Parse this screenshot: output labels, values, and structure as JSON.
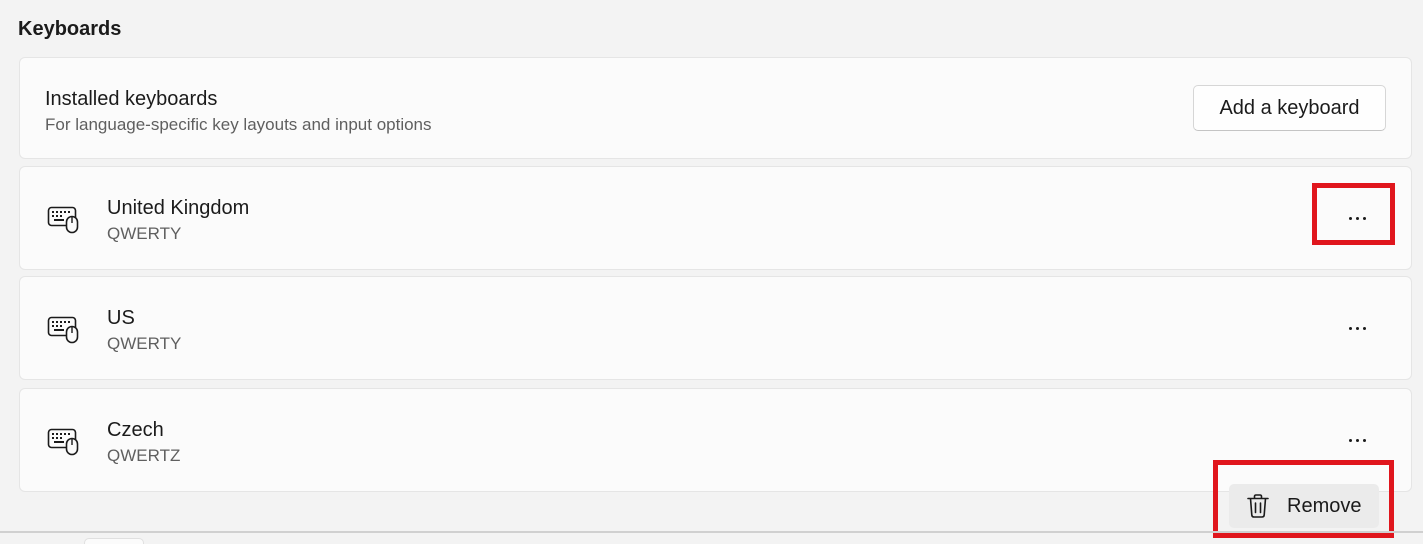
{
  "section": {
    "title": "Keyboards"
  },
  "installed": {
    "title": "Installed keyboards",
    "subtitle": "For language-specific key layouts and input options",
    "add_button_label": "Add a keyboard"
  },
  "keyboards": [
    {
      "name": "United Kingdom",
      "layout": "QWERTY",
      "icon": "keyboard-icon",
      "more_icon": "more-options-icon"
    },
    {
      "name": "US",
      "layout": "QWERTY",
      "icon": "keyboard-icon",
      "more_icon": "more-options-icon"
    },
    {
      "name": "Czech",
      "layout": "QWERTZ",
      "icon": "keyboard-icon",
      "more_icon": "more-options-icon"
    }
  ],
  "context_menu": {
    "items": [
      {
        "label": "Remove",
        "icon": "trash-icon"
      }
    ]
  },
  "colors": {
    "highlight": "#e0161d",
    "background": "#f3f3f3",
    "card": "#fbfbfb"
  }
}
